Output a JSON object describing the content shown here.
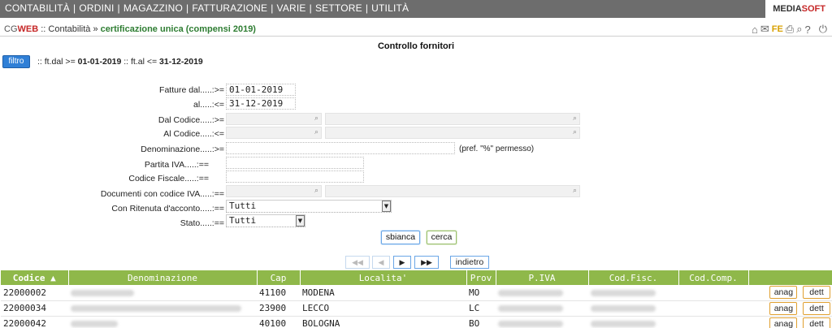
{
  "menu": [
    "CONTABILITÀ",
    "ORDINI",
    "MAGAZZINO",
    "FATTURAZIONE",
    "VARIE",
    "SETTORE",
    "UTILITÀ"
  ],
  "brand": {
    "part1": "MEDIA",
    "part2": "SOFT"
  },
  "breadcrumb": {
    "app_a": "CG",
    "app_b": "WEB",
    "separator_1": ":: ",
    "section": "Contabilità",
    "separator_2": " » ",
    "current": "certificazione unica (compensi 2019)"
  },
  "topicons": {
    "fe_label": "FE",
    "home": "home-icon",
    "mail": "mail-icon",
    "print": "print-icon",
    "search": "search-icon",
    "help": "help-icon",
    "power": "power-icon"
  },
  "page_title": "Controllo fornitori",
  "filter": {
    "button_label": "filtro",
    "summary_prefix_1": ":: ft.dal >= ",
    "summary_val_1": "01-01-2019",
    "summary_prefix_2": " :: ft.al <= ",
    "summary_val_2": "31-12-2019"
  },
  "form": {
    "fatture_dal_label": "Fatture dal.....:>=",
    "fatture_dal_value": "01-01-2019",
    "al_label": "al.....:<=",
    "al_value": "31-12-2019",
    "dal_codice_label": "Dal Codice.....:>=",
    "al_codice_label": "Al Codice.....:<=",
    "denominazione_label": "Denominazione.....:>=",
    "denominazione_hint": "(pref. \"%\" permesso)",
    "partita_iva_label": "Partita IVA.....:==",
    "codice_fiscale_label": "Codice Fiscale.....:==",
    "documenti_cf_label": "Documenti con codice IVA.....:==",
    "ritenuta_label": "Con Ritenuta d'acconto.....:==",
    "ritenuta_value": "Tutti",
    "stato_label": "Stato.....:==",
    "stato_value": "Tutti",
    "sbianca_label": "sbianca",
    "cerca_label": "cerca"
  },
  "pager": {
    "first": "◀◀",
    "prev": "◀",
    "next": "▶",
    "last": "▶▶",
    "back_label": "indietro"
  },
  "table": {
    "columns": [
      "Codice ▲",
      "Denominazione",
      "Cap",
      "Localita'",
      "Prov",
      "P.IVA",
      "Cod.Fisc.",
      "Cod.Comp.",
      ""
    ],
    "rows": [
      {
        "codice": "22000002",
        "cap": "41100",
        "localita": "MODENA",
        "prov": "MO"
      },
      {
        "codice": "22000034",
        "cap": "23900",
        "localita": "LECCO",
        "prov": "LC"
      },
      {
        "codice": "22000042",
        "cap": "40100",
        "localita": "BOLOGNA",
        "prov": "BO"
      }
    ],
    "anag_label": "anag",
    "dett_label": "dett"
  }
}
